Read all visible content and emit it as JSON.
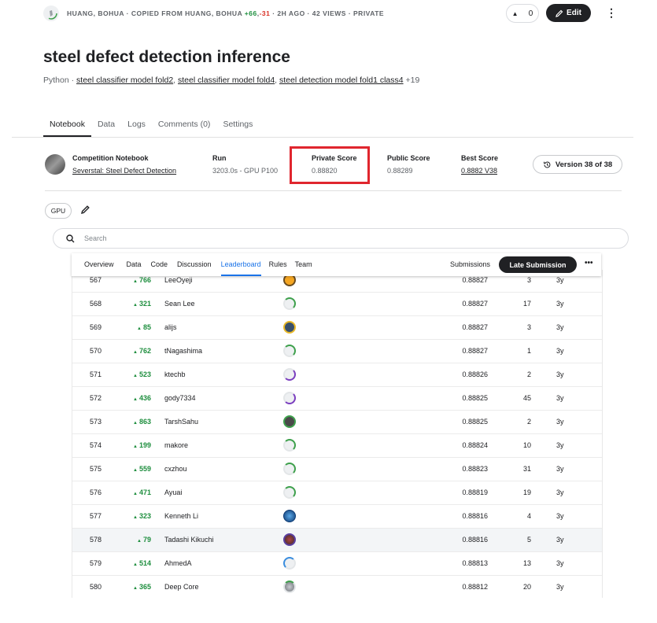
{
  "meta": {
    "author": "HUANG, BOHUA",
    "copied": "· COPIED FROM HUANG, BOHUA",
    "plus": "+66",
    "minus": "-31",
    "rest": "· 2H AGO · 42 VIEWS · PRIVATE"
  },
  "vote_count": "0",
  "edit_label": "Edit",
  "title": "steel defect detection inference",
  "subline": {
    "lang": "Python ·",
    "link1": "steel classifier model fold2",
    "link2": "steel classifier model fold4",
    "link3": "steel detection model fold1 class4",
    "more": "+19"
  },
  "tabs": [
    "Notebook",
    "Data",
    "Logs",
    "Comments (0)",
    "Settings"
  ],
  "info": {
    "competition_label": "Competition Notebook",
    "competition_name": "Severstal: Steel Defect Detection",
    "run_label": "Run",
    "run_value": "3203.0s - GPU P100",
    "private_label": "Private Score",
    "private_value": "0.88820",
    "public_label": "Public Score",
    "public_value": "0.88289",
    "best_label": "Best Score",
    "best_value": "0.8882 V38",
    "version": "Version 38 of 38"
  },
  "gpu_label": "GPU",
  "search_placeholder": "Search",
  "comp_nav": [
    "Overview",
    "Data",
    "Code",
    "Discussion",
    "Leaderboard",
    "Rules",
    "Team"
  ],
  "submissions_label": "Submissions",
  "late_submission_label": "Late Submission",
  "colors": {
    "highlight": "#e0262e",
    "up": "#1e8e3e",
    "down": "#d93025",
    "active_tab": "#1a73e8"
  },
  "leaderboard": [
    {
      "rank": "567",
      "delta": "766",
      "team": "LeeOyeji",
      "score": "0.88827",
      "entries": "3",
      "last": "3y",
      "avatar": "orange"
    },
    {
      "rank": "568",
      "delta": "321",
      "team": "Sean Lee",
      "score": "0.88827",
      "entries": "17",
      "last": "3y",
      "avatar": "green"
    },
    {
      "rank": "569",
      "delta": "85",
      "team": "alijs",
      "score": "0.88827",
      "entries": "3",
      "last": "3y",
      "avatar": "gold"
    },
    {
      "rank": "570",
      "delta": "762",
      "team": "tNagashima",
      "score": "0.88827",
      "entries": "1",
      "last": "3y",
      "avatar": "green"
    },
    {
      "rank": "571",
      "delta": "523",
      "team": "ktechb",
      "score": "0.88826",
      "entries": "2",
      "last": "3y",
      "avatar": "purple"
    },
    {
      "rank": "572",
      "delta": "436",
      "team": "gody7334",
      "score": "0.88825",
      "entries": "45",
      "last": "3y",
      "avatar": "purple"
    },
    {
      "rank": "573",
      "delta": "863",
      "team": "TarshSahu",
      "score": "0.88825",
      "entries": "2",
      "last": "3y",
      "avatar": "dark"
    },
    {
      "rank": "574",
      "delta": "199",
      "team": "makore",
      "score": "0.88824",
      "entries": "10",
      "last": "3y",
      "avatar": "green"
    },
    {
      "rank": "575",
      "delta": "559",
      "team": "cxzhou",
      "score": "0.88823",
      "entries": "31",
      "last": "3y",
      "avatar": "green"
    },
    {
      "rank": "576",
      "delta": "471",
      "team": "Ayuai",
      "score": "0.88819",
      "entries": "19",
      "last": "3y",
      "avatar": "green"
    },
    {
      "rank": "577",
      "delta": "323",
      "team": "Kenneth Li",
      "score": "0.88816",
      "entries": "4",
      "last": "3y",
      "avatar": "blue"
    },
    {
      "rank": "578",
      "delta": "79",
      "team": "Tadashi Kikuchi",
      "score": "0.88816",
      "entries": "5",
      "last": "3y",
      "avatar": "photo"
    },
    {
      "rank": "579",
      "delta": "514",
      "team": "AhmedA",
      "score": "0.88813",
      "entries": "13",
      "last": "3y",
      "avatar": "blue-ring"
    },
    {
      "rank": "580",
      "delta": "365",
      "team": "Deep Core",
      "score": "0.88812",
      "entries": "20",
      "last": "3y",
      "avatar": "green-dark"
    }
  ]
}
